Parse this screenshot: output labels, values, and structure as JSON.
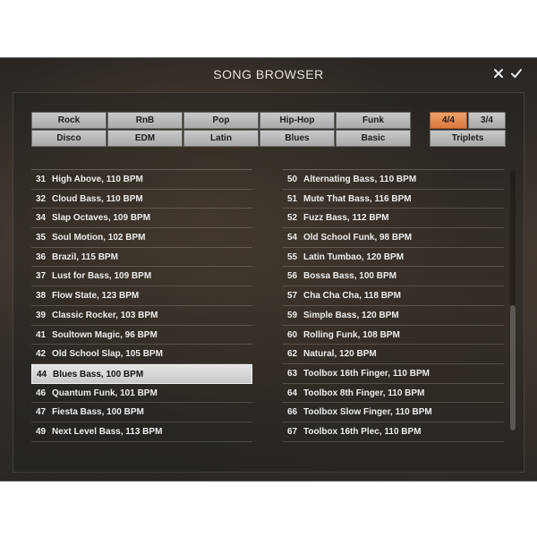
{
  "window": {
    "title": "SONG BROWSER"
  },
  "genres": [
    {
      "label": "Rock"
    },
    {
      "label": "RnB"
    },
    {
      "label": "Pop"
    },
    {
      "label": "Hip-Hop"
    },
    {
      "label": "Funk"
    },
    {
      "label": "Disco"
    },
    {
      "label": "EDM"
    },
    {
      "label": "Latin"
    },
    {
      "label": "Blues"
    },
    {
      "label": "Basic"
    }
  ],
  "time_signatures": {
    "four_four": "4/4",
    "three_four": "3/4",
    "triplets": "Triplets",
    "selected": "4/4"
  },
  "songs_left": [
    {
      "num": "31",
      "name": "High Above, 110 BPM"
    },
    {
      "num": "32",
      "name": "Cloud Bass, 110 BPM"
    },
    {
      "num": "34",
      "name": "Slap Octaves, 109 BPM"
    },
    {
      "num": "35",
      "name": "Soul Motion, 102 BPM"
    },
    {
      "num": "36",
      "name": "Brazil, 115 BPM"
    },
    {
      "num": "37",
      "name": "Lust for Bass, 109 BPM"
    },
    {
      "num": "38",
      "name": "Flow State, 123 BPM"
    },
    {
      "num": "39",
      "name": "Classic Rocker, 103 BPM"
    },
    {
      "num": "41",
      "name": "Soultown Magic, 96 BPM"
    },
    {
      "num": "42",
      "name": "Old School Slap, 105 BPM"
    },
    {
      "num": "44",
      "name": "Blues Bass, 100 BPM"
    },
    {
      "num": "46",
      "name": "Quantum Funk, 101 BPM"
    },
    {
      "num": "47",
      "name": "Fiesta Bass, 100 BPM"
    },
    {
      "num": "49",
      "name": "Next Level Bass, 113 BPM"
    }
  ],
  "songs_right": [
    {
      "num": "50",
      "name": "Alternating Bass, 110 BPM"
    },
    {
      "num": "51",
      "name": "Mute That Bass, 116 BPM"
    },
    {
      "num": "52",
      "name": "Fuzz Bass, 112 BPM"
    },
    {
      "num": "54",
      "name": "Old School Funk, 98 BPM"
    },
    {
      "num": "55",
      "name": "Latin Tumbao, 120 BPM"
    },
    {
      "num": "56",
      "name": "Bossa Bass, 100 BPM"
    },
    {
      "num": "57",
      "name": "Cha Cha Cha, 118 BPM"
    },
    {
      "num": "59",
      "name": "Simple Bass, 120 BPM"
    },
    {
      "num": "60",
      "name": "Rolling Funk, 108 BPM"
    },
    {
      "num": "62",
      "name": "Natural, 120 BPM"
    },
    {
      "num": "63",
      "name": "Toolbox 16th Finger, 110 BPM"
    },
    {
      "num": "64",
      "name": "Toolbox 8th Finger, 110 BPM"
    },
    {
      "num": "66",
      "name": "Toolbox Slow Finger, 110 BPM"
    },
    {
      "num": "67",
      "name": "Toolbox 16th Plec, 110 BPM"
    }
  ],
  "selected_song": "44",
  "colors": {
    "accent": "#e08a4f",
    "selected_row": "#d6d6d6"
  },
  "icons": {
    "close": "close-icon",
    "confirm": "check-icon"
  }
}
